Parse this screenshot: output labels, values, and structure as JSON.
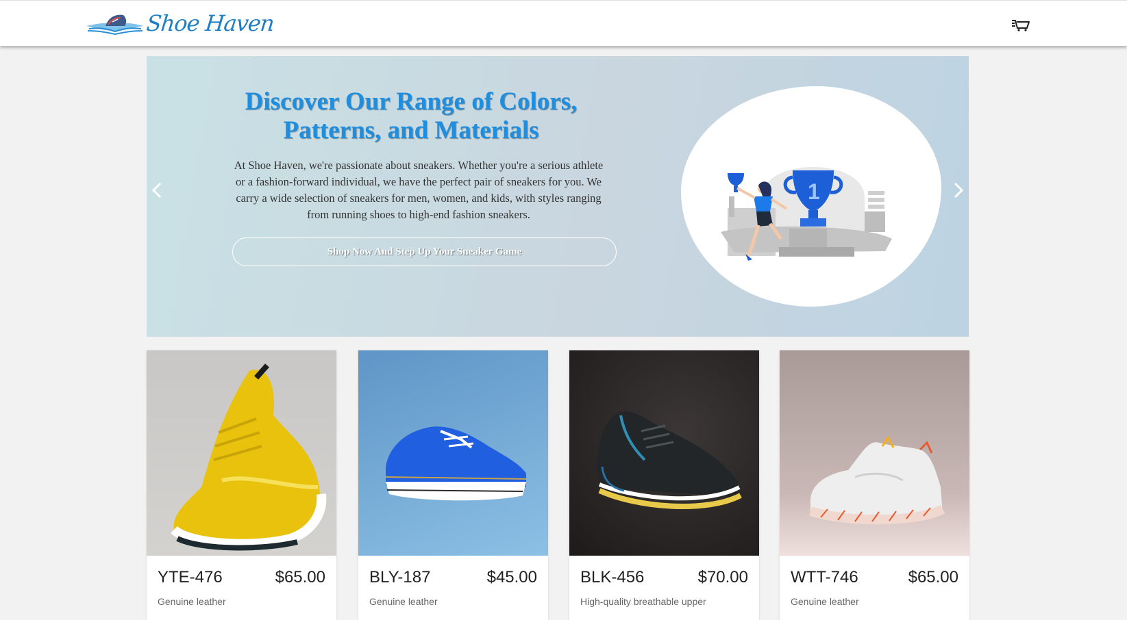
{
  "header": {
    "logo_text": "Shoe Haven",
    "cart_icon": "cart-icon"
  },
  "hero": {
    "title": "Discover Our Range of Colors, Patterns, and Materials",
    "body": "At Shoe Haven, we're passionate about sneakers. Whether you're a serious athlete or a fashion-forward individual, we have the perfect pair of sneakers for you. We carry a wide selection of sneakers for men, women, and kids, with styles ranging from running shoes to high-end fashion sneakers.",
    "cta_label": "Shop Now And Step Up Your Sneaker Game",
    "prev_icon": "chevron-left-icon",
    "next_icon": "chevron-right-icon",
    "illustration": "trophy-winner-illustration",
    "trophy_text": "1"
  },
  "products": [
    {
      "name": "YTE-476",
      "price": "$65.00",
      "description": "Genuine leather",
      "image": "yellow-sneaker"
    },
    {
      "name": "BLY-187",
      "price": "$45.00",
      "description": "Genuine leather",
      "image": "blue-canvas-sneaker"
    },
    {
      "name": "BLK-456",
      "price": "$70.00",
      "description": "High-quality breathable upper",
      "image": "black-running-sneaker"
    },
    {
      "name": "WTT-746",
      "price": "$65.00",
      "description": "Genuine leather",
      "image": "white-sneaker"
    }
  ],
  "colors": {
    "brand_blue": "#1f7fc4",
    "hero_title": "#1e8fe0",
    "accent_trophy": "#1c5fd6"
  }
}
